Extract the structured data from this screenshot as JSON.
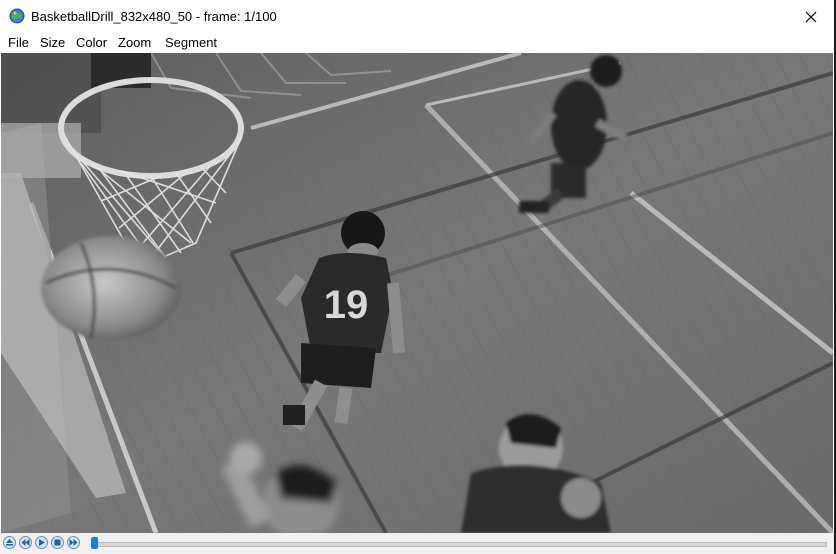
{
  "window": {
    "title": "BasketballDrill_832x480_50 - frame: 1/100",
    "icon": "globe-app-icon",
    "close_icon": "close-icon"
  },
  "menu": {
    "items": [
      "File",
      "Size",
      "Color",
      "Zoom",
      "Segment"
    ]
  },
  "video": {
    "description_icon": "video-frame",
    "jersey_number": "19"
  },
  "playback": {
    "buttons": [
      "eject-icon",
      "rewind-icon",
      "play-icon",
      "stop-icon",
      "fast-forward-icon"
    ],
    "frame_current": 1,
    "frame_total": 100,
    "progress": 0.01
  },
  "colors": {
    "accent": "#1e7ed6",
    "title_bg": "#ffffff",
    "control_bg": "#f0f0f0"
  }
}
